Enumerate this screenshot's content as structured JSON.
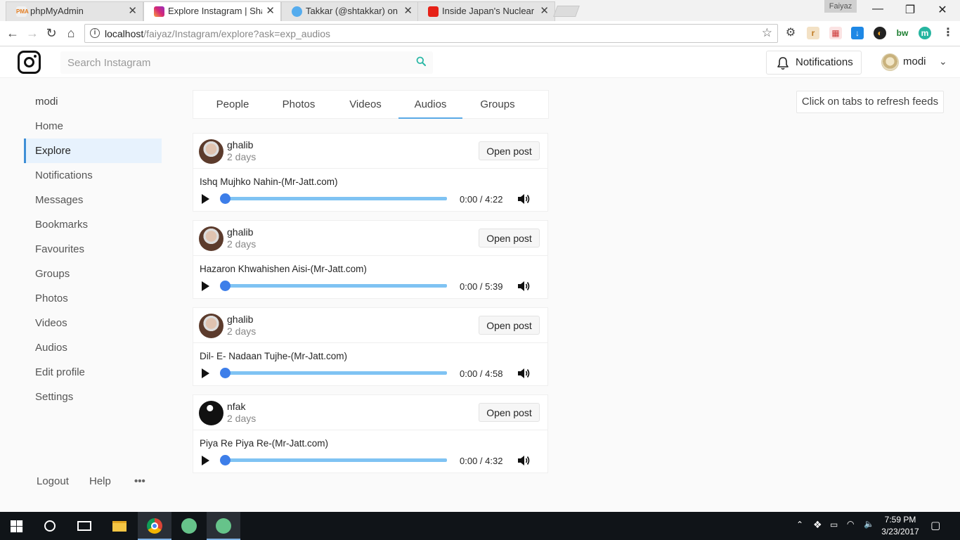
{
  "browser": {
    "tabs": [
      {
        "title": "phpMyAdmin",
        "favicon": "pma-icon",
        "active": false
      },
      {
        "title": "Explore Instagram | Share",
        "favicon": "instagram-icon",
        "active": true
      },
      {
        "title": "Takkar (@shtakkar) on Tw",
        "favicon": "twitter-icon",
        "active": false
      },
      {
        "title": "Inside Japan's Nuclear M",
        "favicon": "youtube-icon",
        "active": false
      }
    ],
    "profile_name": "Faiyaz",
    "url_host": "localhost",
    "url_path": "/faiyaz/Instagram/explore?ask=exp_audios"
  },
  "header": {
    "search_placeholder": "Search Instagram",
    "notifications_label": "Notifications",
    "username": "modi"
  },
  "sidebar": {
    "user": "modi",
    "items": [
      "Home",
      "Explore",
      "Notifications",
      "Messages",
      "Bookmarks",
      "Favourites",
      "Groups",
      "Photos",
      "Videos",
      "Audios",
      "Edit profile",
      "Settings"
    ],
    "active": "Explore",
    "footer": {
      "logout": "Logout",
      "help": "Help",
      "more": "•••"
    }
  },
  "feed_tabs": {
    "items": [
      "People",
      "Photos",
      "Videos",
      "Audios",
      "Groups"
    ],
    "active": "Audios"
  },
  "hint": "Click on tabs to refresh feeds",
  "posts": [
    {
      "user": "ghalib",
      "time": "2 days",
      "open_label": "Open post",
      "title": "Ishq Mujhko Nahin-(Mr-Jatt.com)",
      "time_display": "0:00 / 4:22"
    },
    {
      "user": "ghalib",
      "time": "2 days",
      "open_label": "Open post",
      "title": "Hazaron Khwahishen Aisi-(Mr-Jatt.com)",
      "time_display": "0:00 / 5:39"
    },
    {
      "user": "ghalib",
      "time": "2 days",
      "open_label": "Open post",
      "title": "Dil- E- Nadaan Tujhe-(Mr-Jatt.com)",
      "time_display": "0:00 / 4:58"
    },
    {
      "user": "nfak",
      "time": "2 days",
      "open_label": "Open post",
      "title": "Piya Re Piya Re-(Mr-Jatt.com)",
      "time_display": "0:00 / 4:32"
    }
  ],
  "taskbar": {
    "time": "7:59 PM",
    "date": "3/23/2017"
  },
  "colors": {
    "accent": "#3f8fd6",
    "active_tab_underline": "#5aa9e6",
    "track": "#7fc3f3",
    "thumb": "#3d7ee9",
    "search_icon": "#2bb8a6"
  }
}
